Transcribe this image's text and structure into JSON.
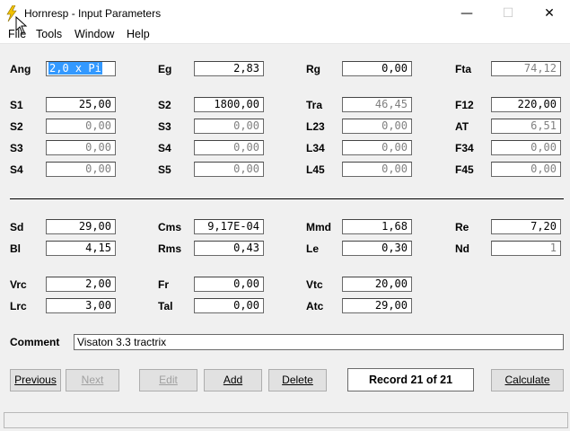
{
  "window": {
    "title": "Hornresp - Input Parameters",
    "minimize": "—",
    "maximize": "☐",
    "close": "✕"
  },
  "menu": [
    "File",
    "Tools",
    "Window",
    "Help"
  ],
  "fields": {
    "ang": {
      "label": "Ang",
      "value": "2,0 x Pi"
    },
    "eg": {
      "label": "Eg",
      "value": "2,83"
    },
    "rg": {
      "label": "Rg",
      "value": "0,00"
    },
    "fta": {
      "label": "Fta",
      "value": "74,12"
    },
    "s1a": {
      "label": "S1",
      "value": "25,00"
    },
    "s2b": {
      "label": "S2",
      "value": "1800,00"
    },
    "tra": {
      "label": "Tra",
      "value": "46,45"
    },
    "f12": {
      "label": "F12",
      "value": "220,00"
    },
    "s2a": {
      "label": "S2",
      "value": "0,00"
    },
    "s3b": {
      "label": "S3",
      "value": "0,00"
    },
    "l23": {
      "label": "L23",
      "value": "0,00"
    },
    "at": {
      "label": "AT",
      "value": "6,51"
    },
    "s3a": {
      "label": "S3",
      "value": "0,00"
    },
    "s4b": {
      "label": "S4",
      "value": "0,00"
    },
    "l34": {
      "label": "L34",
      "value": "0,00"
    },
    "f34": {
      "label": "F34",
      "value": "0,00"
    },
    "s4a": {
      "label": "S4",
      "value": "0,00"
    },
    "s5b": {
      "label": "S5",
      "value": "0,00"
    },
    "l45": {
      "label": "L45",
      "value": "0,00"
    },
    "f45": {
      "label": "F45",
      "value": "0,00"
    },
    "sd": {
      "label": "Sd",
      "value": "29,00"
    },
    "cms": {
      "label": "Cms",
      "value": "9,17E-04"
    },
    "mmd": {
      "label": "Mmd",
      "value": "1,68"
    },
    "re": {
      "label": "Re",
      "value": "7,20"
    },
    "bl": {
      "label": "Bl",
      "value": "4,15"
    },
    "rms": {
      "label": "Rms",
      "value": "0,43"
    },
    "le": {
      "label": "Le",
      "value": "0,30"
    },
    "nd": {
      "label": "Nd",
      "value": "1"
    },
    "vrc": {
      "label": "Vrc",
      "value": "2,00"
    },
    "fr": {
      "label": "Fr",
      "value": "0,00"
    },
    "vtc": {
      "label": "Vtc",
      "value": "20,00"
    },
    "lrc": {
      "label": "Lrc",
      "value": "3,00"
    },
    "tal": {
      "label": "Tal",
      "value": "0,00"
    },
    "atc": {
      "label": "Atc",
      "value": "29,00"
    }
  },
  "comment": {
    "label": "Comment",
    "value": "Visaton 3.3 tractrix"
  },
  "buttons": {
    "previous": "Previous",
    "next": "Next",
    "edit": "Edit",
    "add": "Add",
    "delete": "Delete",
    "calculate": "Calculate"
  },
  "record": "Record 21 of 21",
  "colors": {
    "selection": "#3399ff",
    "icon": "#f2c200"
  }
}
